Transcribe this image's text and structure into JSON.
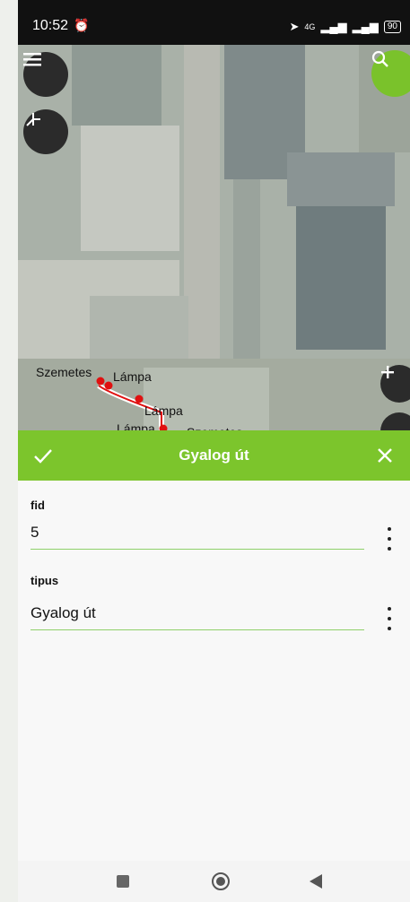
{
  "status_bar": {
    "time": "10:52",
    "signal_label": "4G",
    "battery": "90"
  },
  "map": {
    "labels": [
      "Szemetes",
      "Lámpa",
      "Lámpa",
      "Lámpa",
      "Szemetes"
    ],
    "point_color": "#e01010",
    "line_color": "#e01010"
  },
  "form": {
    "title": "Gyalog út",
    "header_color": "#7cc52c",
    "fields": [
      {
        "label": "fid",
        "value": "5"
      },
      {
        "label": "tipus",
        "value": "Gyalog út"
      }
    ]
  },
  "icons": {
    "menu": "menu-icon",
    "digitize": "node-icon",
    "search": "search-icon",
    "zoom_in": "plus-icon",
    "confirm": "check-icon",
    "close": "close-icon",
    "nav_recents": "square-icon",
    "nav_home": "circle-icon",
    "nav_back": "triangle-back-icon"
  }
}
